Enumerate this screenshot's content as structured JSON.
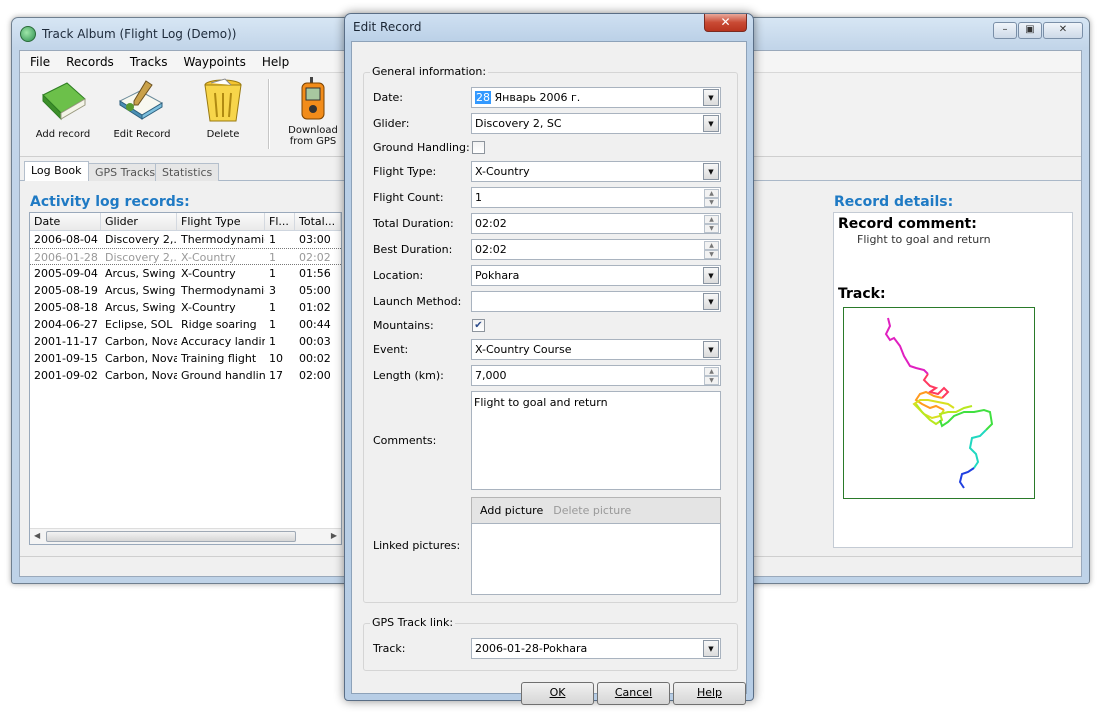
{
  "main_window": {
    "title": "Track Album  (Flight Log (Demo))",
    "menu": [
      "File",
      "Records",
      "Tracks",
      "Waypoints",
      "Help"
    ],
    "toolbar": {
      "add_record": "Add record",
      "edit_record": "Edit Record",
      "delete": "Delete",
      "download_line1": "Download",
      "download_line2": "from GPS"
    },
    "tabs": [
      "Log Book",
      "GPS Tracks",
      "Statistics"
    ],
    "active_tab": "Log Book",
    "log_title": "Activity log records:",
    "columns": [
      "Date",
      "Glider",
      "Flight Type",
      "Fl...",
      "Total..."
    ],
    "rows": [
      [
        "2006-08-04",
        "Discovery 2,...",
        "Thermodynamic",
        "1",
        "03:00"
      ],
      [
        "2006-01-28",
        "Discovery 2,...",
        "X-Country",
        "1",
        "02:02"
      ],
      [
        "2005-09-04",
        "Arcus, Swing",
        "X-Country",
        "1",
        "01:56"
      ],
      [
        "2005-08-19",
        "Arcus, Swing",
        "Thermodynamic",
        "3",
        "05:00"
      ],
      [
        "2005-08-18",
        "Arcus, Swing",
        "X-Country",
        "1",
        "01:02"
      ],
      [
        "2004-06-27",
        "Eclipse, SOL",
        "Ridge soaring",
        "1",
        "00:44"
      ],
      [
        "2001-11-17",
        "Carbon, Nova",
        "Accuracy landing",
        "1",
        "00:03"
      ],
      [
        "2001-09-15",
        "Carbon, Nova",
        "Training flight",
        "10",
        "00:02"
      ],
      [
        "2001-09-02",
        "Carbon, Nova",
        "Ground handling",
        "17",
        "02:00"
      ]
    ],
    "selected_row": 1,
    "details_title": "Record details:",
    "comment_heading": "Record comment:",
    "comment_text": "Flight to goal and return",
    "track_heading": "Track:"
  },
  "dialog": {
    "title": "Edit Record",
    "close_glyph": "✕",
    "general_group": "General information:",
    "labels": {
      "date": "Date:",
      "glider": "Glider:",
      "ground_handling": "Ground Handling:",
      "flight_type": "Flight Type:",
      "flight_count": "Flight Count:",
      "total_duration": "Total Duration:",
      "best_duration": "Best Duration:",
      "location": "Location:",
      "launch_method": "Launch Method:",
      "mountains": "Mountains:",
      "event": "Event:",
      "length": "Length (km):",
      "comments": "Comments:",
      "linked_pictures": "Linked pictures:"
    },
    "values": {
      "date_day": "28",
      "date_rest": " Январь 2006 г.",
      "glider": "Discovery 2, SC",
      "ground_handling": false,
      "flight_type": "X-Country",
      "flight_count": "1",
      "total_duration": "02:02",
      "best_duration": "02:02",
      "location": "Pokhara",
      "launch_method": "",
      "mountains": true,
      "event": "X-Country Course",
      "length": "7,000",
      "comments": "Flight to goal and return"
    },
    "add_picture": "Add picture",
    "delete_picture": "Delete picture",
    "gps_group": "GPS Track link:",
    "track_label": "Track:",
    "track_value": "2006-01-28-Pokhara",
    "buttons": {
      "ok": "OK",
      "cancel": "Cancel",
      "help": "Help"
    }
  }
}
